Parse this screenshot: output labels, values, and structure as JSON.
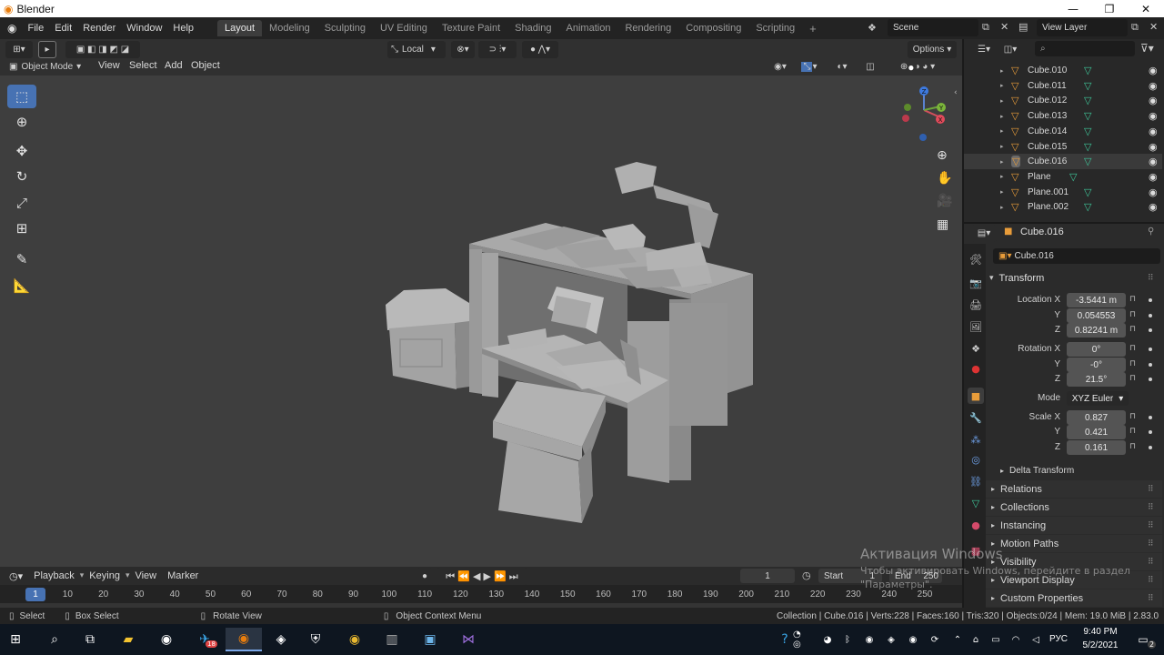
{
  "window": {
    "title": "Blender",
    "app_icon": "blender-logo-icon",
    "controls": [
      "minimize-icon",
      "maximize-icon",
      "close-icon"
    ]
  },
  "menu": [
    "File",
    "Edit",
    "Render",
    "Window",
    "Help"
  ],
  "workspaces": [
    "Layout",
    "Modeling",
    "Sculpting",
    "UV Editing",
    "Texture Paint",
    "Shading",
    "Animation",
    "Rendering",
    "Compositing",
    "Scripting"
  ],
  "active_workspace": "Layout",
  "scene": "Scene",
  "view_layer": "View Layer",
  "viewport_header": {
    "transform_orientation": "Local",
    "options_label": "Options",
    "mode": "Object Mode",
    "menu": [
      "View",
      "Select",
      "Add",
      "Object"
    ]
  },
  "outliner": {
    "search_placeholder": "",
    "rows": [
      {
        "name": "Cube.010",
        "selected": false
      },
      {
        "name": "Cube.011",
        "selected": false
      },
      {
        "name": "Cube.012",
        "selected": false
      },
      {
        "name": "Cube.013",
        "selected": false
      },
      {
        "name": "Cube.014",
        "selected": false
      },
      {
        "name": "Cube.015",
        "selected": false
      },
      {
        "name": "Cube.016",
        "selected": true
      },
      {
        "name": "Plane",
        "selected": false
      },
      {
        "name": "Plane.001",
        "selected": false
      },
      {
        "name": "Plane.002",
        "selected": false
      }
    ]
  },
  "properties": {
    "object_name": "Cube.016",
    "transform_title": "Transform",
    "location": {
      "label": "Location X",
      "x": "-3.5441 m",
      "y": "0.054553",
      "z": "0.82241 m"
    },
    "rotation": {
      "label": "Rotation X",
      "x": "0°",
      "y": "-0°",
      "z": "21.5°"
    },
    "mode_label": "Mode",
    "mode": "XYZ Euler",
    "scale": {
      "label": "Scale X",
      "x": "0.827",
      "y": "0.421",
      "z": "0.161"
    },
    "axis_y": "Y",
    "axis_z": "Z",
    "delta_transform": "Delta Transform",
    "sections": [
      "Relations",
      "Collections",
      "Instancing",
      "Motion Paths",
      "Visibility",
      "Viewport Display",
      "Custom Properties"
    ]
  },
  "timeline": {
    "menu": [
      "Playback",
      "Keying",
      "View",
      "Marker"
    ],
    "current_frame": "1",
    "start_label": "Start",
    "start": "1",
    "end_label": "End",
    "end": "250",
    "ticks": [
      "1",
      "10",
      "20",
      "30",
      "40",
      "50",
      "60",
      "70",
      "80",
      "90",
      "100",
      "110",
      "120",
      "130",
      "140",
      "150",
      "160",
      "170",
      "180",
      "190",
      "200",
      "210",
      "220",
      "230",
      "240",
      "250"
    ]
  },
  "statusbar": {
    "select": "Select",
    "box_select": "Box Select",
    "rotate_view": "Rotate View",
    "context_menu": "Object Context Menu",
    "stats": "Collection | Cube.016 | Verts:228 | Faces:160 | Tris:320 | Objects:0/24 | Mem: 19.0 MiB | 2.83.0"
  },
  "watermark": {
    "title": "Активация Windows",
    "subtitle": "Чтобы активировать Windows, перейдите в раздел \"Параметры\"."
  },
  "taskbar": {
    "language": "РУС",
    "time": "9:40 PM",
    "date": "5/2/2021",
    "notification_count": "2",
    "telegram_badge": "18"
  },
  "colors": {
    "accent": "#4772b3",
    "active_object": "#e89c3a",
    "mesh_data": "#3fc79a",
    "viewport_bg": "#3e3e3e"
  }
}
